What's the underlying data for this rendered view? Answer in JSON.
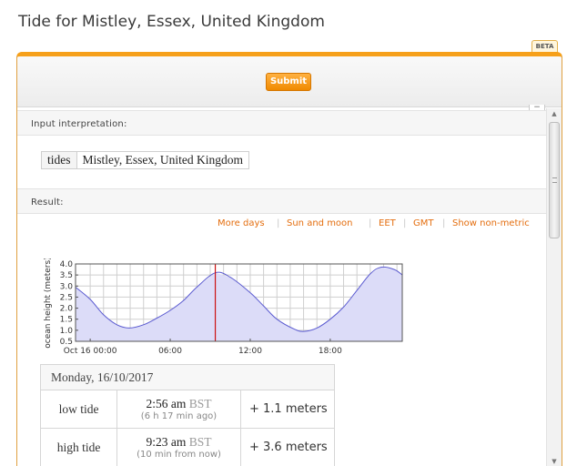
{
  "page": {
    "title": "Tide for Mistley, Essex, United Kingdom"
  },
  "badge": {
    "label": "BETA"
  },
  "form": {
    "submit_label": "Submit"
  },
  "pods": {
    "input": {
      "header": "Input interpretation:",
      "key": "tides",
      "value": "Mistley, Essex, United Kingdom"
    },
    "result": {
      "header": "Result:",
      "links": [
        "More days",
        "Sun and moon",
        "EET",
        "GMT",
        "Show non-metric"
      ],
      "separator": "|"
    }
  },
  "chart_data": {
    "type": "area",
    "ylabel": "ocean height (meters)",
    "ylim": [
      0.5,
      4.0
    ],
    "xlim": [
      -1.1,
      23.4
    ],
    "yticks": [
      "0.5",
      "1.0",
      "1.5",
      "2.0",
      "2.5",
      "3.0",
      "3.5",
      "4.0"
    ],
    "xticks": [
      {
        "x": 0,
        "label": "Oct 16 00:00"
      },
      {
        "x": 6,
        "label": "06:00"
      },
      {
        "x": 12,
        "label": "12:00"
      },
      {
        "x": 18,
        "label": "18:00"
      }
    ],
    "x_unit": "hours since 2017-10-16 00:00 BST",
    "series": [
      {
        "x": [
          -1.1,
          0.0,
          1.0,
          2.0,
          2.93,
          4.0,
          5.0,
          6.0,
          7.0,
          8.0,
          9.38,
          10.5,
          12.0,
          13.0,
          14.0,
          15.3,
          16.0,
          17.0,
          18.0,
          19.0,
          20.0,
          21.0,
          21.8,
          22.8,
          23.4
        ],
        "y": [
          2.95,
          2.4,
          1.7,
          1.25,
          1.1,
          1.25,
          1.55,
          1.9,
          2.35,
          2.95,
          3.6,
          3.4,
          2.7,
          2.1,
          1.5,
          1.05,
          0.95,
          1.1,
          1.5,
          2.05,
          2.8,
          3.55,
          3.85,
          3.75,
          3.5
        ]
      }
    ],
    "current_time_x": 9.38,
    "colors": {
      "line": "#5a5ad0",
      "fill": "#dcdcf8",
      "marker": "#cc1111",
      "grid": "#cfcfcf"
    }
  },
  "tides": {
    "date": "Monday, 16/10/2017",
    "rows": [
      {
        "kind": "low tide",
        "time": "2:56 am",
        "tz": "BST",
        "note": "(6 h  17 min ago)",
        "height": "+ 1.1 meters"
      },
      {
        "kind": "high tide",
        "time": "9:23 am",
        "tz": "BST",
        "note": "(10 min from now)",
        "height": "+ 3.6 meters"
      }
    ]
  }
}
